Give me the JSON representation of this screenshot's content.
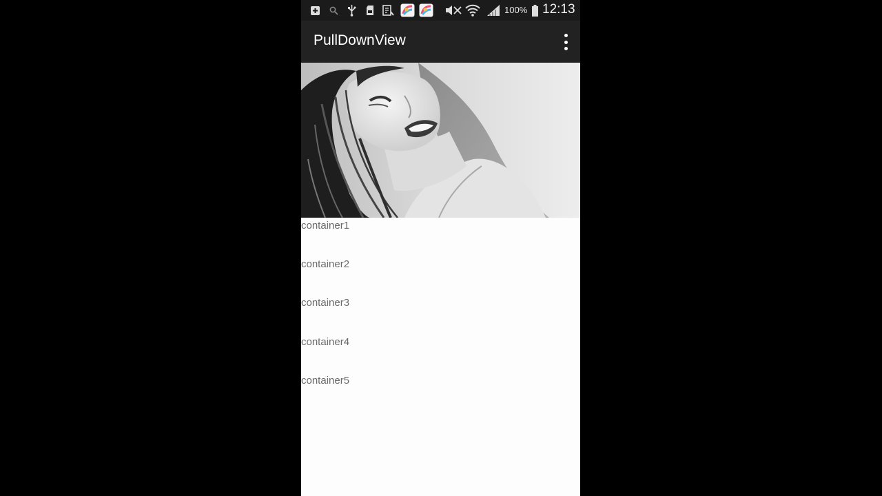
{
  "status_bar": {
    "battery_percent": "100%",
    "time": "12:13",
    "icons": [
      "notification-icon",
      "search-icon",
      "usb-icon",
      "sd-card-icon",
      "screenshot-icon",
      "app-icon",
      "app-icon",
      "mute-icon",
      "wifi-icon",
      "signal-icon",
      "battery-icon"
    ]
  },
  "action_bar": {
    "title": "PullDownView",
    "overflow_icon": "more-vert-icon"
  },
  "header": {
    "image": "photo-header-image"
  },
  "containers": [
    {
      "label": "container1"
    },
    {
      "label": "container2"
    },
    {
      "label": "container3"
    },
    {
      "label": "container4"
    },
    {
      "label": "container5"
    }
  ]
}
